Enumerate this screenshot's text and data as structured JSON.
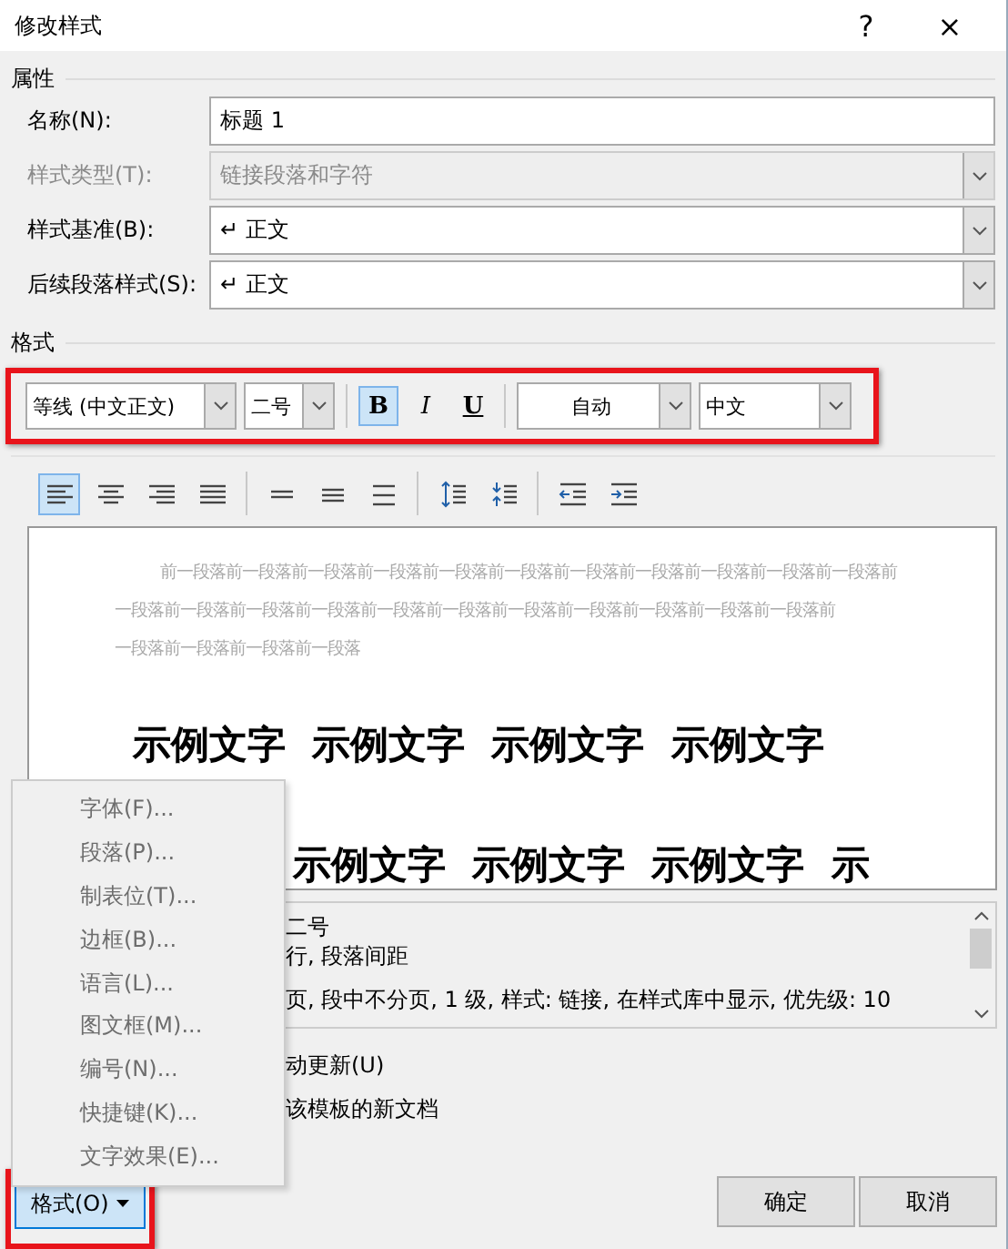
{
  "window": {
    "title": "修改样式",
    "help": "?",
    "close": "×"
  },
  "properties": {
    "heading": "属性",
    "fields": [
      {
        "label": "名称(N):",
        "value": "标题 1",
        "kind": "text",
        "disabled": false
      },
      {
        "label": "样式类型(T):",
        "value": "链接段落和字符",
        "kind": "select",
        "disabled": true
      },
      {
        "label": "样式基准(B):",
        "value": "↵ 正文",
        "kind": "select",
        "disabled": false
      },
      {
        "label": "后续段落样式(S):",
        "value": "↵ 正文",
        "kind": "select",
        "disabled": false
      }
    ]
  },
  "format": {
    "heading": "格式",
    "highlighted": true,
    "font": "等线 (中文正文)",
    "size": "二号",
    "styles": [
      {
        "kind": "bold",
        "label": "B",
        "selected": true
      },
      {
        "kind": "italic",
        "label": "I",
        "selected": false
      },
      {
        "kind": "underline",
        "label": "U",
        "selected": false
      }
    ],
    "font_color": "自动",
    "language": "中文"
  },
  "paragraph_buttons": [
    {
      "kind": "align-left",
      "selected": true
    },
    {
      "kind": "align-center",
      "selected": false
    },
    {
      "kind": "align-right",
      "selected": false
    },
    {
      "kind": "justify",
      "selected": false
    },
    {
      "kind": "single-space",
      "selected": false
    },
    {
      "kind": "one-half-space",
      "selected": false
    },
    {
      "kind": "double-space",
      "selected": false
    },
    {
      "kind": "space-before",
      "selected": false
    },
    {
      "kind": "space-after",
      "selected": false
    },
    {
      "kind": "outdent",
      "selected": false
    },
    {
      "kind": "indent",
      "selected": false
    }
  ],
  "preview": {
    "previous_paragraph": [
      "前一段落前一段落前一段落前一段落前一段落前一段落前一段落前一段落前一段落前一段落前一段落前",
      "一段落前一段落前一段落前一段落前一段落前一段落前一段落前一段落前一段落前一段落前一段落前",
      "一段落前一段落前一段落前一段落"
    ],
    "sample_lines": [
      "示例文字  示例文字  示例文字  示例文字",
      "示例文字  示例文字  示例文字  示"
    ]
  },
  "description": [
    "二号",
    "行, 段落间距",
    "页, 段中不分页, 1 级, 样式: 链接, 在样式库中显示, 优先级: 10"
  ],
  "options": [
    "动更新(U)",
    "该模板的新文档"
  ],
  "menu": [
    "字体(F)...",
    "段落(P)...",
    "制表位(T)...",
    "边框(B)...",
    "语言(L)...",
    "图文框(M)...",
    "编号(N)...",
    "快捷键(K)...",
    "文字效果(E)..."
  ],
  "format_button": {
    "label": "格式(O)",
    "highlighted": true
  },
  "ok": "确定",
  "cancel": "取消"
}
